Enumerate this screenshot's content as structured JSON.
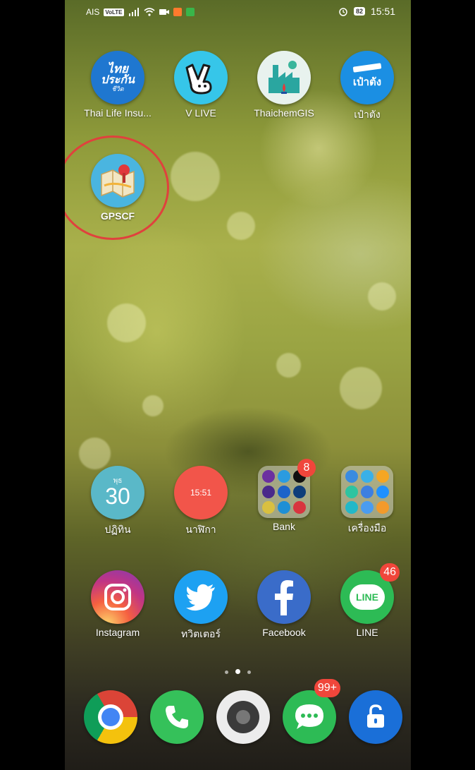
{
  "status_bar": {
    "carrier": "AIS",
    "network_badge": "VoLTE",
    "battery": "82",
    "time": "15:51"
  },
  "apps_row1": [
    {
      "label": "Thai Life Insu...",
      "icon_text": [
        "ไทย",
        "ประกัน",
        "ชีวิต"
      ],
      "icon": "thai-life-icon"
    },
    {
      "label": "V LIVE",
      "icon": "v-live-icon"
    },
    {
      "label": "ThaichemGIS",
      "icon": "factory-icon"
    },
    {
      "label": "เป๋าตัง",
      "icon_text": "เป๋าตัง",
      "icon": "wallet-icon"
    }
  ],
  "apps_row2": [
    {
      "label": "GPSCF",
      "icon": "map-pin-icon"
    }
  ],
  "widgets_row": {
    "calendar": {
      "label": "ปฏิทิน",
      "day_abbr": "พุธ",
      "day": "30"
    },
    "clock": {
      "label": "นาฬิกา",
      "time": "15:51"
    },
    "bank_folder": {
      "label": "Bank",
      "badge": "8"
    },
    "tools_folder": {
      "label": "เครื่องมือ"
    }
  },
  "apps_row4": [
    {
      "label": "Instagram",
      "icon": "instagram-icon"
    },
    {
      "label": "ทวิตเตอร์",
      "icon": "twitter-icon"
    },
    {
      "label": "Facebook",
      "icon": "facebook-icon"
    },
    {
      "label": "LINE",
      "icon_text": "LINE",
      "badge": "46",
      "icon": "line-icon"
    }
  ],
  "dock": [
    {
      "name": "chrome",
      "icon": "chrome-icon"
    },
    {
      "name": "phone",
      "icon": "phone-icon"
    },
    {
      "name": "camera",
      "icon": "camera-icon"
    },
    {
      "name": "messages",
      "badge": "99+",
      "icon": "messages-icon"
    },
    {
      "name": "lock",
      "icon": "lock-icon"
    }
  ],
  "colors": {
    "highlight": "#e0413d",
    "badge": "#f0463b"
  }
}
